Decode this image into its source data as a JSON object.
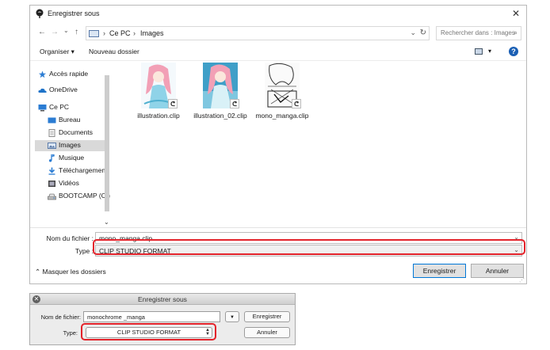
{
  "win": {
    "title": "Enregistrer sous",
    "close": "✕",
    "nav": {
      "back": "←",
      "forward": "→",
      "recent": "⌄",
      "up": "↑"
    },
    "breadcrumb": [
      "Ce PC",
      "Images"
    ],
    "breadcrumb_sep": "›",
    "address_dropdown": "⌄",
    "refresh": "↻",
    "search_placeholder": "Rechercher dans : Images",
    "search_icon": "⌕",
    "organize": "Organiser ▾",
    "new_folder": "Nouveau dossier",
    "view_dropdown": "▾",
    "help": "?",
    "sidebar": [
      {
        "label": "Accès rapide",
        "icon": "star-icon",
        "color": "#2b7cd3"
      },
      {
        "label": "OneDrive",
        "icon": "cloud-icon",
        "color": "#1e73c9"
      },
      {
        "label": "Ce PC",
        "icon": "computer-icon",
        "color": "#2b7cd3"
      },
      {
        "label": "Bureau",
        "icon": "desktop-icon",
        "color": "#2b7cd3"
      },
      {
        "label": "Documents",
        "icon": "document-icon",
        "color": "#8a8a8a"
      },
      {
        "label": "Images",
        "icon": "images-icon",
        "color": "#5a7aa8"
      },
      {
        "label": "Musique",
        "icon": "music-icon",
        "color": "#2b7cd3"
      },
      {
        "label": "Téléchargement",
        "icon": "download-icon",
        "color": "#2b7cd3"
      },
      {
        "label": "Vidéos",
        "icon": "video-icon",
        "color": "#444444"
      },
      {
        "label": "BOOTCAMP (C:)",
        "icon": "drive-icon",
        "color": "#555555"
      }
    ],
    "scroll_down": "⌄",
    "files": [
      {
        "name": "illustration.clip",
        "style": "color"
      },
      {
        "name": "illustration_02.clip",
        "style": "color-blue"
      },
      {
        "name": "mono_manga.clip",
        "style": "mono"
      }
    ],
    "file_badge": "ᕦ",
    "filename_label": "Nom du fichier :",
    "filename_value": "mono_manga.clip",
    "type_label": "Type :",
    "type_value": "CLIP STUDIO FORMAT",
    "field_chevron": "⌄",
    "hide_folders": "Masquer les dossiers",
    "hide_chevron": "⌃",
    "save_button": "Enregistrer",
    "cancel_button": "Annuler",
    "grip": "⋰"
  },
  "mac": {
    "title": "Enregistrer sous",
    "close": "✕",
    "filename_label": "Nom de fichier:",
    "filename_value": "monochrome _manga",
    "expand": "▼",
    "save_button": "Enregistrer",
    "type_label": "Type:",
    "type_value": "CLIP STUDIO FORMAT",
    "stepper_up": "▲",
    "stepper_down": "▼",
    "cancel_button": "Annuler"
  },
  "colors": {
    "highlight": "#e3232b",
    "help": "#1a5fb4",
    "primary_border": "#0078d7"
  }
}
